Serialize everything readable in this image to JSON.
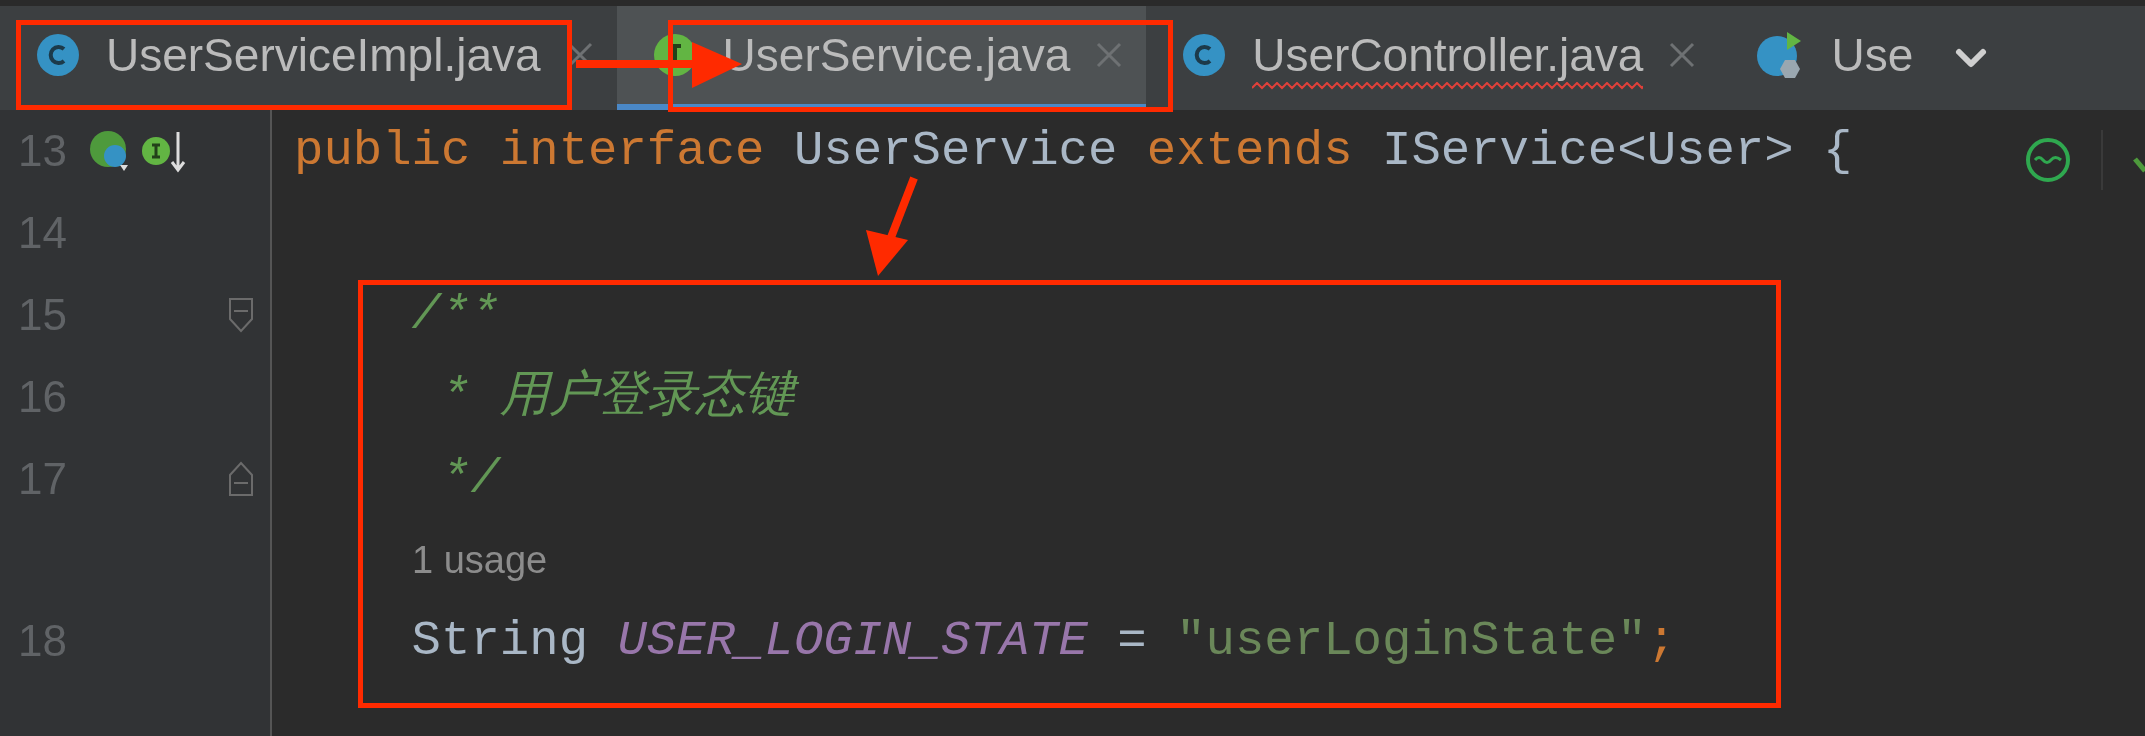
{
  "tabs": [
    {
      "label": "UserServiceImpl.java",
      "kind": "class",
      "selected": false,
      "closable": true,
      "error": false
    },
    {
      "label": "UserService.java",
      "kind": "interface",
      "selected": true,
      "closable": true,
      "error": false
    },
    {
      "label": "UserController.java",
      "kind": "class",
      "selected": false,
      "closable": true,
      "error": true
    },
    {
      "label": "Use",
      "kind": "runnable",
      "selected": false,
      "closable": false,
      "error": false
    }
  ],
  "editor": {
    "lines": [
      {
        "kind": "code",
        "number": "13",
        "gutter": [
          {
            "kind": "implemented"
          },
          {
            "kind": "overridden"
          }
        ],
        "tokens": [
          {
            "kind": "keyword",
            "text": "public interface "
          },
          {
            "kind": "plain",
            "text": "UserService "
          },
          {
            "kind": "keyword",
            "text": "extends "
          },
          {
            "kind": "plain",
            "text": "IService<User> {"
          }
        ]
      },
      {
        "kind": "code",
        "number": "14"
      },
      {
        "kind": "code",
        "number": "15",
        "gutter": [
          {
            "kind": "fold_start"
          }
        ],
        "tokens": [
          {
            "kind": "comment",
            "text": "    /**"
          }
        ]
      },
      {
        "kind": "code",
        "number": "16",
        "tokens": [
          {
            "kind": "comment",
            "text": "     * 用户登录态键"
          }
        ]
      },
      {
        "kind": "code",
        "number": "17",
        "gutter": [
          {
            "kind": "fold_end"
          }
        ],
        "tokens": [
          {
            "kind": "comment",
            "text": "     */"
          }
        ]
      },
      {
        "kind": "inlay",
        "text": "1 usage"
      },
      {
        "kind": "code",
        "number": "18",
        "tokens": [
          {
            "kind": "plain",
            "text": "    String "
          },
          {
            "kind": "constant",
            "text": "USER_LOGIN_STATE"
          },
          {
            "kind": "plain",
            "text": " = "
          },
          {
            "kind": "string",
            "text": "\"userLoginState\""
          },
          {
            "kind": "keyword",
            "text": ";"
          }
        ]
      }
    ]
  }
}
